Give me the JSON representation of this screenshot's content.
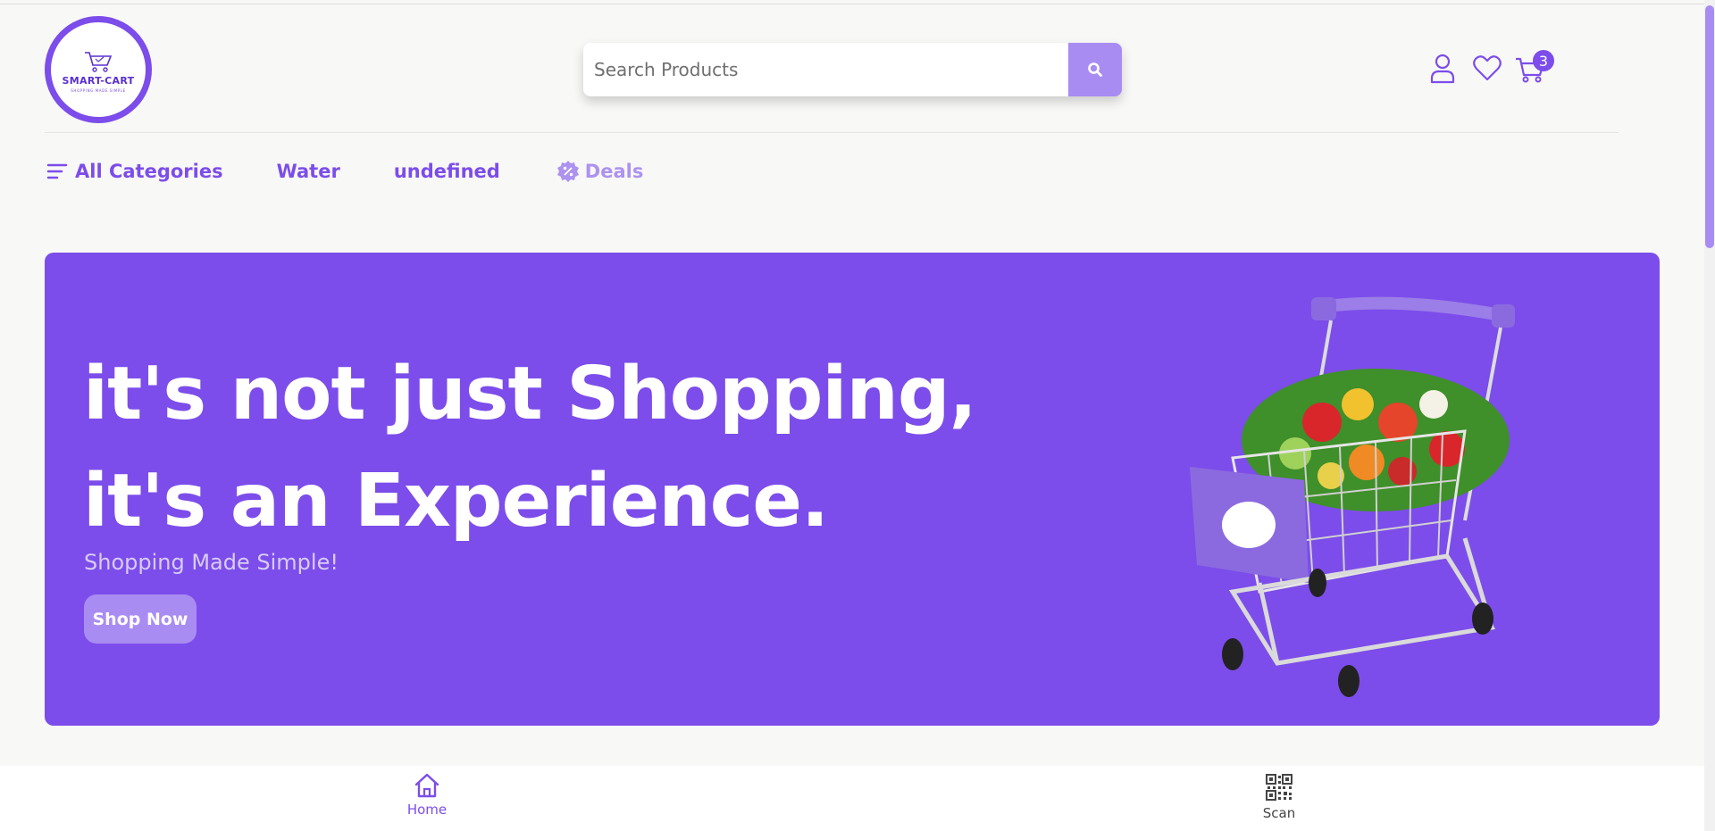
{
  "brand": {
    "logo_text": "SMART-CART",
    "tagline": "SHOPPING MADE SIMPLE",
    "accent_color": "#7c4dea",
    "accent_light": "#a98cf2"
  },
  "search": {
    "placeholder": "Search Products",
    "icon": "search-icon"
  },
  "header_icons": {
    "account": "user-icon",
    "wishlist": "heart-icon",
    "cart": "cart-icon",
    "cart_count": "3"
  },
  "nav": {
    "all_categories": "All Categories",
    "items": [
      "Water",
      "undefined"
    ],
    "deals": "Deals"
  },
  "hero": {
    "title": "it's not just Shopping, it's an Experience.",
    "subtitle": "Shopping Made Simple!",
    "cta": "Shop Now",
    "image": "shopping-cart-with-vegetables"
  },
  "bottom_nav": [
    {
      "label": "Home",
      "icon": "home-icon",
      "active": true
    },
    {
      "label": "Scan",
      "icon": "qr-code-icon",
      "active": false
    }
  ]
}
